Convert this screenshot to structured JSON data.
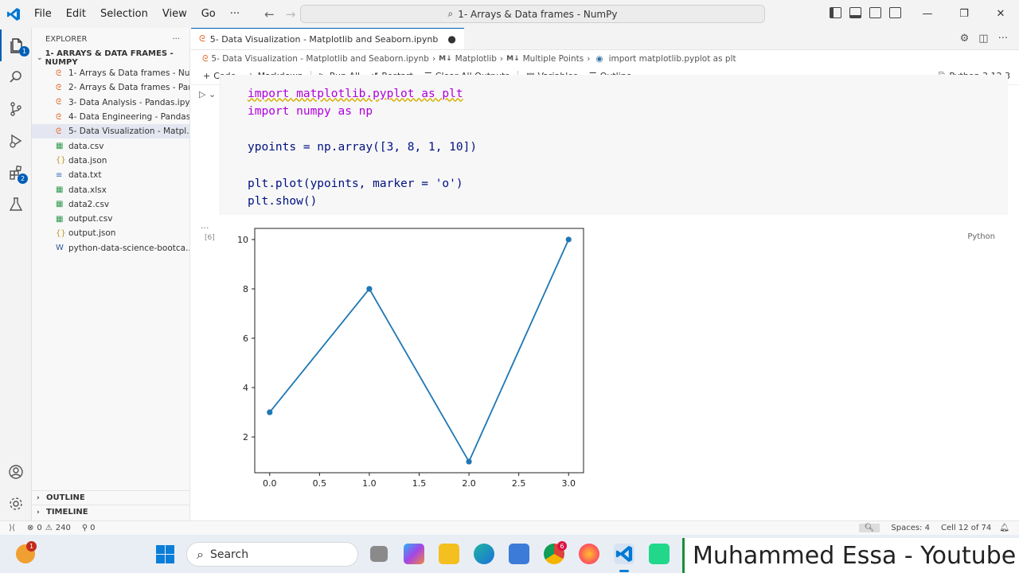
{
  "menu": [
    "File",
    "Edit",
    "Selection",
    "View",
    "Go",
    "···"
  ],
  "command_center": "1- Arrays & Data frames - NumPy",
  "explorer": {
    "title": "EXPLORER",
    "folder": "1- ARRAYS & DATA FRAMES - NUMPY",
    "files": [
      {
        "name": "1- Arrays & Data frames - Nu...",
        "icon": "notebook"
      },
      {
        "name": "2- Arrays & Data frames - Pan...",
        "icon": "notebook"
      },
      {
        "name": "3- Data Analysis - Pandas.ipynb",
        "icon": "notebook"
      },
      {
        "name": "4- Data Engineering - Pandas....",
        "icon": "notebook"
      },
      {
        "name": "5- Data Visualization - Matpl...",
        "icon": "notebook",
        "selected": true
      },
      {
        "name": "data.csv",
        "icon": "csv"
      },
      {
        "name": "data.json",
        "icon": "json"
      },
      {
        "name": "data.txt",
        "icon": "txt"
      },
      {
        "name": "data.xlsx",
        "icon": "xlsx"
      },
      {
        "name": "data2.csv",
        "icon": "csv"
      },
      {
        "name": "output.csv",
        "icon": "csv"
      },
      {
        "name": "output.json",
        "icon": "json"
      },
      {
        "name": "python-data-science-bootca...",
        "icon": "word"
      }
    ],
    "outline": "OUTLINE",
    "timeline": "TIMELINE"
  },
  "tab": {
    "label": "5- Data Visualization - Matplotlib and Seaborn.ipynb"
  },
  "breadcrumbs": [
    "5- Data Visualization - Matplotlib and Seaborn.ipynb",
    "Matplotlib",
    "Multiple Points",
    "import matplotlib.pyplot as plt"
  ],
  "toolbar": {
    "code": "Code",
    "markdown": "Markdown",
    "run_all": "Run All",
    "restart": "Restart",
    "clear": "Clear All Outputs",
    "variables": "Variables",
    "outline": "Outline",
    "more": "···",
    "kernel": "Python 3.12.3"
  },
  "cell": {
    "number": "[6]",
    "language": "Python",
    "code_line1": "import matplotlib.pyplot as plt",
    "code_line2": "import numpy as np",
    "code_line3": "ypoints = np.array([3, 8, 1, 10])",
    "code_line4": "plt.plot(ypoints, marker = 'o')",
    "code_line5": "plt.show()"
  },
  "chart_data": {
    "type": "line",
    "x": [
      0,
      1,
      2,
      3
    ],
    "values": [
      3,
      8,
      1,
      10
    ],
    "marker": "o",
    "color": "#1f77b4",
    "xticks": [
      "0.0",
      "0.5",
      "1.0",
      "1.5",
      "2.0",
      "2.5",
      "3.0"
    ],
    "yticks": [
      "2",
      "4",
      "6",
      "8",
      "10"
    ],
    "xlim": [
      -0.15,
      3.15
    ],
    "ylim": [
      0.55,
      10.45
    ],
    "grid": false
  },
  "status": {
    "errors": "0",
    "warnings": "240",
    "ports": "0",
    "spaces": "Spaces: 4",
    "cell": "Cell 12 of 74"
  },
  "taskbar": {
    "search": "Search",
    "badge": "1",
    "chrome_badge": "6"
  },
  "watermark": "Muhammed Essa - Youtube"
}
